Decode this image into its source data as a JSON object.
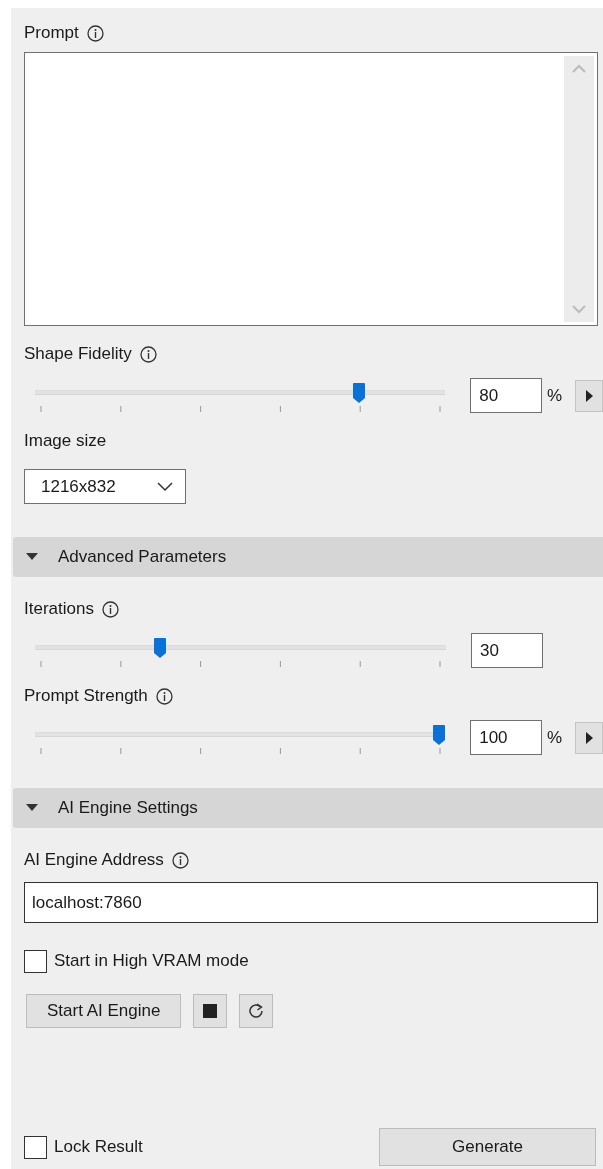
{
  "prompt": {
    "label": "Prompt",
    "info": true
  },
  "controls": [
    {
      "kind": "slider",
      "label": "Shape Fidelity",
      "info": true,
      "level": 0.8,
      "value": "80",
      "unit": "%",
      "stepper": true
    },
    {
      "kind": "dropdown",
      "label": "Image size",
      "info": false,
      "value": "1216x832"
    }
  ],
  "sections": [
    {
      "title": "Advanced Parameters",
      "expanded": true,
      "controls": [
        {
          "kind": "slider",
          "label": "Iterations",
          "info": true,
          "level": 0.3,
          "value": "30",
          "stepper": false
        },
        {
          "kind": "slider",
          "label": "Prompt Strength",
          "info": true,
          "level": 1.0,
          "value": "100",
          "unit": "%",
          "stepper": true
        }
      ]
    },
    {
      "title": "AI Engine Settings",
      "expanded": true,
      "controls": [
        {
          "kind": "text",
          "label": "AI Engine Address",
          "info": true,
          "value": "localhost:7860"
        },
        {
          "kind": "checkbox",
          "label": "Start in High VRAM mode",
          "checked": false
        },
        {
          "kind": "buttons",
          "buttons": [
            {
              "kind": "text",
              "label": "Start AI Engine"
            },
            {
              "kind": "stop"
            },
            {
              "kind": "refresh"
            }
          ]
        }
      ]
    }
  ],
  "footer": {
    "lock": {
      "label": "Lock Result",
      "checked": false
    },
    "generate": "Generate"
  }
}
